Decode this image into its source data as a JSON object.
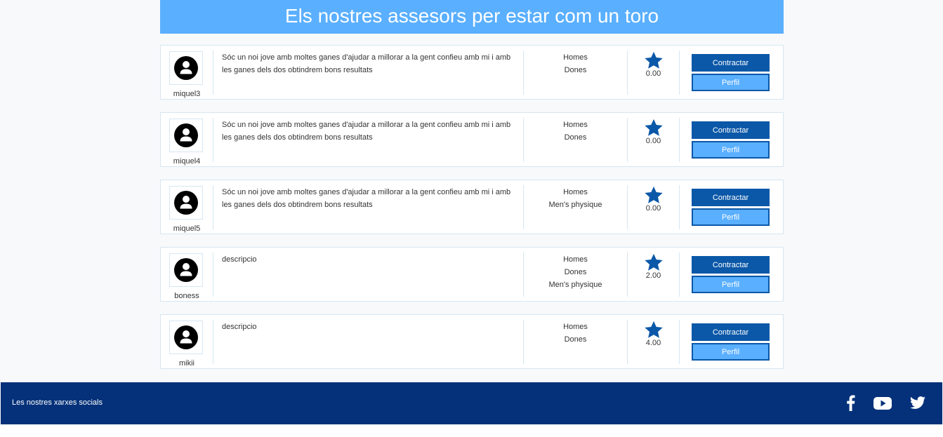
{
  "header": {
    "title": "Els nostres assesors per estar com un toro"
  },
  "advisors": [
    {
      "username": "miquel3",
      "description": "Sóc un noi jove amb moltes ganes d'ajudar a millorar a la gent confieu amb mi i amb les ganes dels dos obtindrem bons resultats",
      "categories": [
        "Homes",
        "Dones"
      ],
      "rating": "0.00",
      "contract_label": "Contractar",
      "profile_label": "Perfil"
    },
    {
      "username": "miquel4",
      "description": "Sóc un noi jove amb moltes ganes d'ajudar a millorar a la gent confieu amb mi i amb les ganes dels dos obtindrem bons resultats",
      "categories": [
        "Homes",
        "Dones"
      ],
      "rating": "0.00",
      "contract_label": "Contractar",
      "profile_label": "Perfil"
    },
    {
      "username": "miquel5",
      "description": "Sóc un noi jove amb moltes ganes d'ajudar a millorar a la gent confieu amb mi i amb les ganes dels dos obtindrem bons resultats",
      "categories": [
        "Homes",
        "Men's physique"
      ],
      "rating": "0.00",
      "contract_label": "Contractar",
      "profile_label": "Perfil"
    },
    {
      "username": "boness",
      "description": "descripcio",
      "categories": [
        "Homes",
        "Dones",
        "Men's physique"
      ],
      "rating": "2.00",
      "contract_label": "Contractar",
      "profile_label": "Perfil"
    },
    {
      "username": "mikii",
      "description": "descripcio",
      "categories": [
        "Homes",
        "Dones"
      ],
      "rating": "4.00",
      "contract_label": "Contractar",
      "profile_label": "Perfil"
    }
  ],
  "footer": {
    "label": "Les nostres xarxes socials",
    "social_icons": [
      "facebook-icon",
      "youtube-icon",
      "twitter-icon"
    ]
  },
  "colors": {
    "header_bg": "#5aafff",
    "primary_button": "#0b58a8",
    "secondary_button": "#5aafff",
    "footer_bg": "#04317a",
    "star": "#0b58a8"
  }
}
